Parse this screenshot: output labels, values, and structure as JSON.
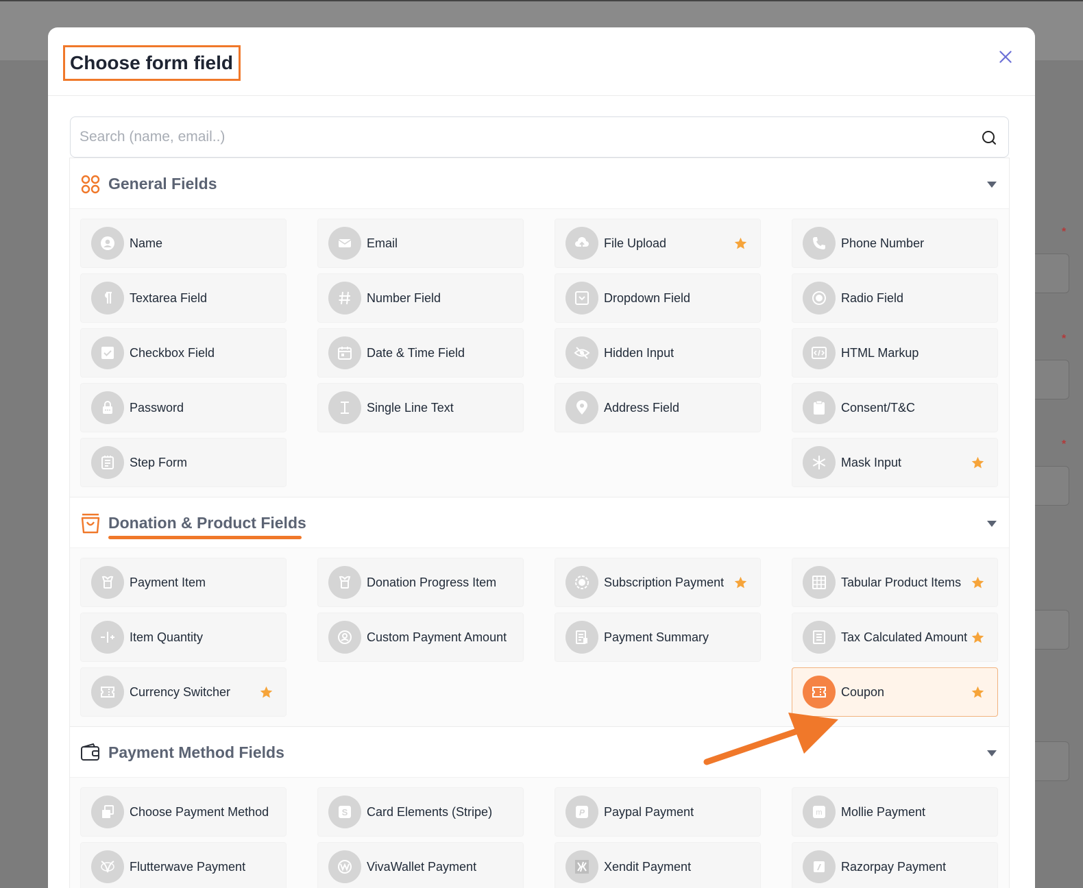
{
  "modal": {
    "title": "Choose form field",
    "search_placeholder": "Search (name, email..)"
  },
  "sections": [
    {
      "title": "General Fields",
      "items": [
        {
          "label": "Name",
          "icon": "user-icon",
          "starred": false
        },
        {
          "label": "Email",
          "icon": "mail-icon",
          "starred": false
        },
        {
          "label": "File Upload",
          "icon": "cloud-upload-icon",
          "starred": true
        },
        {
          "label": "Phone Number",
          "icon": "phone-icon",
          "starred": false
        },
        {
          "label": "Textarea Field",
          "icon": "paragraph-icon",
          "starred": false
        },
        {
          "label": "Number Field",
          "icon": "hash-icon",
          "starred": false
        },
        {
          "label": "Dropdown Field",
          "icon": "dropdown-icon",
          "starred": false
        },
        {
          "label": "Radio Field",
          "icon": "radio-icon",
          "starred": false
        },
        {
          "label": "Checkbox Field",
          "icon": "checkbox-icon",
          "starred": false
        },
        {
          "label": "Date & Time Field",
          "icon": "calendar-icon",
          "starred": false
        },
        {
          "label": "Hidden Input",
          "icon": "eye-off-icon",
          "starred": false
        },
        {
          "label": "HTML Markup",
          "icon": "code-icon",
          "starred": false
        },
        {
          "label": "Password",
          "icon": "lock-icon",
          "starred": false
        },
        {
          "label": "Single Line Text",
          "icon": "text-cursor-icon",
          "starred": false
        },
        {
          "label": "Address Field",
          "icon": "map-pin-icon",
          "starred": false
        },
        {
          "label": "Consent/T&C",
          "icon": "clipboard-icon",
          "starred": false
        },
        {
          "label": "Step Form",
          "icon": "steps-icon",
          "starred": false
        },
        null,
        null,
        {
          "label": "Mask Input",
          "icon": "asterisk-icon",
          "starred": true
        }
      ]
    },
    {
      "title": "Donation & Product Fields",
      "items": [
        {
          "label": "Payment Item",
          "icon": "tag-icon",
          "starred": false
        },
        {
          "label": "Donation Progress Item",
          "icon": "tag-icon",
          "starred": false
        },
        {
          "label": "Subscription Payment",
          "icon": "subscription-icon",
          "starred": true
        },
        {
          "label": "Tabular Product Items",
          "icon": "table-icon",
          "starred": true
        },
        {
          "label": "Item Quantity",
          "icon": "quantity-icon",
          "starred": false
        },
        {
          "label": "Custom Payment Amount",
          "icon": "custom-amount-icon",
          "starred": false
        },
        {
          "label": "Payment Summary",
          "icon": "summary-icon",
          "starred": false
        },
        {
          "label": "Tax Calculated Amount",
          "icon": "tax-icon",
          "starred": true
        },
        {
          "label": "Currency Switcher",
          "icon": "ticket-icon",
          "starred": true
        },
        null,
        null,
        {
          "label": "Coupon",
          "icon": "ticket-icon",
          "starred": true,
          "active": true
        }
      ]
    },
    {
      "title": "Payment Method Fields",
      "items": [
        {
          "label": "Choose Payment Method",
          "icon": "payment-method-icon",
          "starred": false
        },
        {
          "label": "Card Elements (Stripe)",
          "icon": "stripe-icon",
          "starred": false
        },
        {
          "label": "Paypal Payment",
          "icon": "paypal-icon",
          "starred": false
        },
        {
          "label": "Mollie Payment",
          "icon": "mollie-icon",
          "starred": false
        },
        {
          "label": "Flutterwave Payment",
          "icon": "flutterwave-icon",
          "starred": false
        },
        {
          "label": "VivaWallet Payment",
          "icon": "vivawallet-icon",
          "starred": false
        },
        {
          "label": "Xendit Payment",
          "icon": "xendit-icon",
          "starred": false
        },
        {
          "label": "Razorpay Payment",
          "icon": "razorpay-icon",
          "starred": false
        }
      ]
    }
  ],
  "colors": {
    "accent": "#f0782a",
    "star": "#f6a43a",
    "icon_bg": "#d5d5d5",
    "active_bg": "#fff4ea"
  }
}
